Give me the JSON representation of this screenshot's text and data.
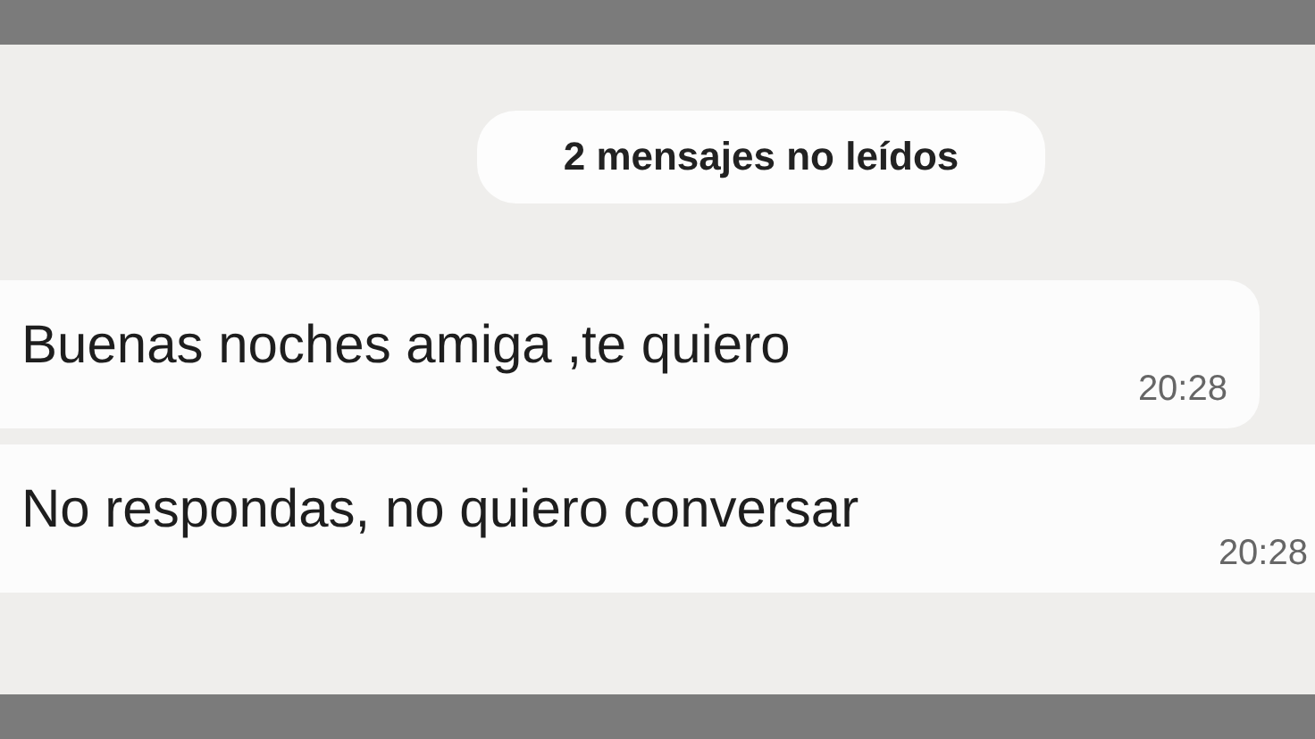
{
  "unread_banner": {
    "text": "2 mensajes no leídos"
  },
  "messages": [
    {
      "text": "Buenas noches amiga ,te quiero",
      "time": "20:28"
    },
    {
      "text": "No respondas, no quiero conversar",
      "time": "20:28"
    }
  ]
}
